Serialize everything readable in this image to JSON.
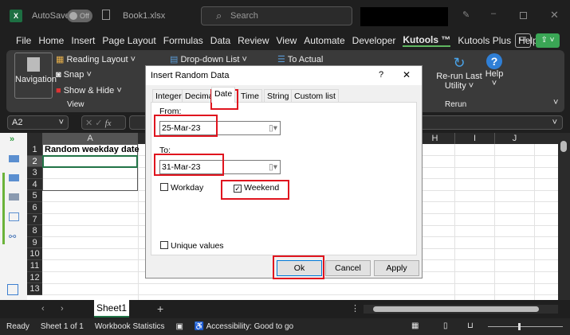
{
  "titlebar": {
    "autosave_label": "AutoSave",
    "toggle_state": "Off",
    "filename": "Book1.xlsx",
    "search_placeholder": "Search"
  },
  "menu": [
    "File",
    "Home",
    "Insert",
    "Page Layout",
    "Formulas",
    "Data",
    "Review",
    "View",
    "Automate",
    "Developer",
    "Kutools ™",
    "Kutools Plus",
    "Help"
  ],
  "ribbon": {
    "navigation": "Navigation",
    "reading_layout": "Reading Layout",
    "snap": "Snap",
    "show_hide": "Show & Hide",
    "view_group": "View",
    "dropdown_list": "Drop-down List",
    "to_actual": "To Actual",
    "rerun_line1": "Re-run Last",
    "rerun_line2": "Utility",
    "rerun_group": "Rerun",
    "help": "Help"
  },
  "formula_bar": {
    "name_box": "A2",
    "fx": "fx"
  },
  "sheet": {
    "columns": [
      "A",
      "H",
      "I",
      "J"
    ],
    "rows": [
      "1",
      "2",
      "3",
      "4",
      "5",
      "6",
      "7",
      "8",
      "9",
      "10",
      "11",
      "12",
      "13"
    ],
    "a1": "Random weekday date"
  },
  "dialog": {
    "title": "Insert Random Data",
    "help": "?",
    "close": "✕",
    "tabs": [
      "Integer",
      "Decimal",
      "Date",
      "Time",
      "String",
      "Custom list"
    ],
    "active_tab": "Date",
    "from_label": "From:",
    "from_value": "25-Mar-23",
    "to_label": "To:",
    "to_value": "31-Mar-23",
    "workday_label": "Workday",
    "workday_checked": false,
    "weekend_label": "Weekend",
    "weekend_checked": true,
    "unique_label": "Unique values",
    "unique_checked": false,
    "ok": "Ok",
    "cancel": "Cancel",
    "apply": "Apply"
  },
  "sheet_tabs": {
    "active": "Sheet1",
    "add": "+"
  },
  "status": {
    "ready": "Ready",
    "sheet_of": "Sheet 1 of 1",
    "stats": "Workbook Statistics",
    "accessibility": "Accessibility: Good to go"
  }
}
